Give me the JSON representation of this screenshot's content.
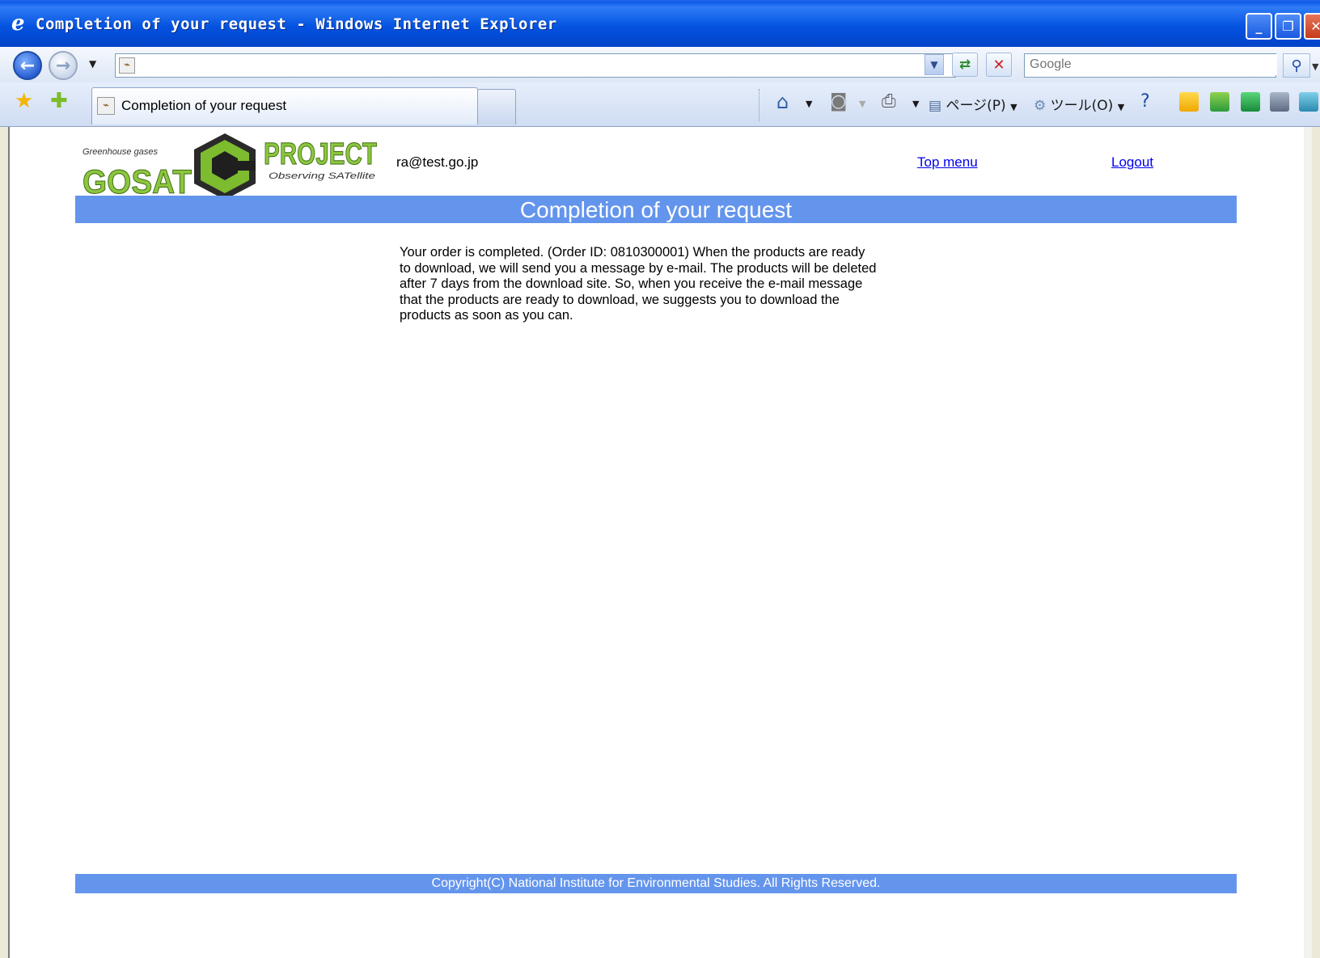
{
  "window": {
    "title": "Completion of your request - Windows Internet Explorer",
    "min_glyph": "_",
    "max_glyph": "❐",
    "close_glyph": "✕"
  },
  "address_bar": {
    "url": "",
    "search_placeholder": "Google"
  },
  "tab": {
    "label": "Completion of your request"
  },
  "command_bar": {
    "page_label": "ページ(P)",
    "tools_label": "ツール(O)"
  },
  "page": {
    "user_email": "ra@test.go.jp",
    "top_menu_link": "Top menu",
    "logout_link": "Logout",
    "banner_title": "Completion of your request",
    "message": "Your order is completed. (Order ID: 0810300001) When the products are ready to download, we will send you a message by e-mail. The products will be deleted after 7 days from the download site. So, when you receive the e-mail message that the products are ready to download, we suggests you to download the products as soon as you can.",
    "footer": "Copyright(C) National Institute for Environmental Studies. All Rights Reserved."
  },
  "logo": {
    "top_text": "Greenhouse gases",
    "main_text": "GOSAT",
    "project_text": "PROJECT",
    "sub_text": "Observing SATellite"
  },
  "colors": {
    "banner": "#6495ed",
    "link": "#0000ee",
    "titlebar": "#0453e0",
    "logo_green": "#8cc63f"
  }
}
